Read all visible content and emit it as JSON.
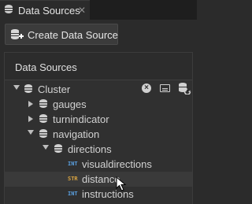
{
  "tab": {
    "title": "Data Sources",
    "close_glyph": "✕"
  },
  "toolbar": {
    "create_label": "Create Data Source"
  },
  "panel": {
    "header": "Data Sources"
  },
  "tree": {
    "cluster": "Cluster",
    "gauges": "gauges",
    "turnindicator": "turnindicator",
    "navigation": "navigation",
    "directions": "directions",
    "visualdirections": {
      "type": "INT",
      "label": "visualdirections"
    },
    "distance": {
      "type": "STR",
      "label": "distance"
    },
    "instructions": {
      "type": "INT",
      "label": "instructions"
    }
  },
  "colors": {
    "int_badge": "#5aa0e0",
    "str_badge": "#d9a441",
    "background": "#2b2b2b"
  }
}
